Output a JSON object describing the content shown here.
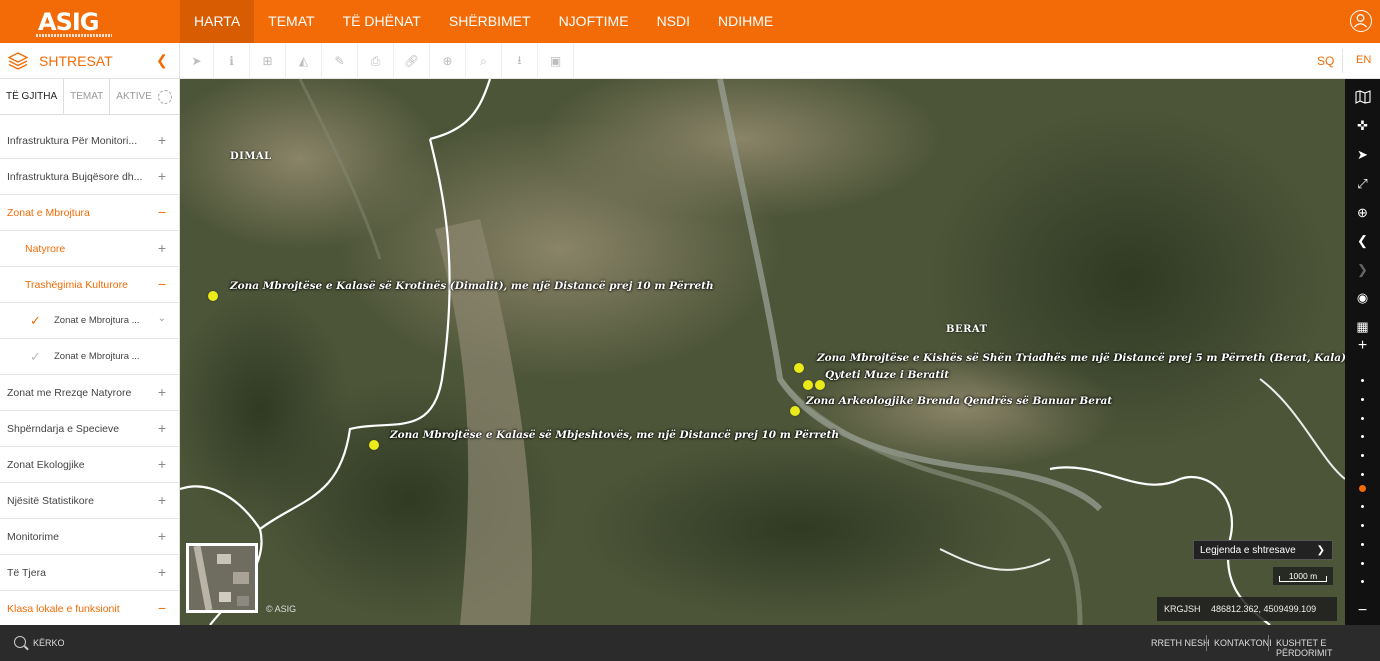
{
  "brand": {
    "logo_text": "ASIG"
  },
  "nav": {
    "items": [
      "HARTA",
      "TEMAT",
      "TË DHËNAT",
      "SHËRBIMET",
      "NJOFTIME",
      "NSDI",
      "NDIHME"
    ],
    "active": "HARTA"
  },
  "layers_panel": {
    "title": "SHTRESAT",
    "tabs": [
      "TË GJITHA",
      "TEMAT",
      "AKTIVE"
    ],
    "active_tab": "TË GJITHA"
  },
  "tree": [
    {
      "label": "Infrastruktura Për Monitori...",
      "level": 1,
      "state": "collapsed"
    },
    {
      "label": "Infrastruktura Bujqësore dh...",
      "level": 1,
      "state": "collapsed"
    },
    {
      "label": "Zonat e Mbrojtura",
      "level": 1,
      "state": "expanded"
    },
    {
      "label": "Natyrore",
      "level": 2,
      "state": "collapsed"
    },
    {
      "label": "Trashëgimia Kulturore",
      "level": 2,
      "state": "expanded"
    },
    {
      "label": "Zonat e Mbrojtura ...",
      "level": 3,
      "checked": true
    },
    {
      "label": "Zonat e Mbrojtura ...",
      "level": 3,
      "checked": false
    },
    {
      "label": "Zonat me Rrezqe Natyrore",
      "level": 1,
      "state": "collapsed"
    },
    {
      "label": "Shpërndarja e Specieve",
      "level": 1,
      "state": "collapsed"
    },
    {
      "label": "Zonat Ekologjike",
      "level": 1,
      "state": "collapsed"
    },
    {
      "label": "Njësitë Statistikore",
      "level": 1,
      "state": "collapsed"
    },
    {
      "label": "Monitorime",
      "level": 1,
      "state": "collapsed"
    },
    {
      "label": "Të Tjera",
      "level": 1,
      "state": "collapsed"
    },
    {
      "label": "Klasa lokale e funksionit",
      "level": 1,
      "state": "expanded"
    }
  ],
  "tree_symbols": {
    "expand": "+",
    "collapse": "−",
    "check": "✓",
    "chevron": "⌄"
  },
  "languages": [
    "SQ",
    "EN"
  ],
  "active_language": "SQ",
  "toolbar_icons": [
    "pointer-icon",
    "info-icon",
    "add-layer-icon",
    "profile-icon",
    "edit-icon",
    "print-icon",
    "link-icon",
    "plus-circle-icon",
    "search-icon",
    "download-icon",
    "image-icon"
  ],
  "map": {
    "place_labels": {
      "dimal": "DIMAL",
      "berat": "BERAT"
    },
    "feature_labels": {
      "krotines": "Zona Mbrojtëse e Kalasë së Krotinës (Dimalit), me një Distancë prej 10 m Përreth",
      "kisha": "Zona Mbrojtëse e Kishës së Shën Triadhës me një Distancë prej 5 m Përreth (Berat, Kala)",
      "qyteti": "Qyteti Muze i Beratit",
      "arkeologjike": "Zona Arkeologjike Brenda Qendrës së Banuar Berat",
      "mbjeshtoves": "Zona Mbrojtëse e Kalasë së Mbjeshtovës, me një Distancë prej 10 m Përreth"
    },
    "copyright": "© ASIG",
    "legend_select": "Legjenda e shtresave",
    "scale": "1000 m",
    "crs": "KRGJSH",
    "coordinates": "486812.362, 4509499.109"
  },
  "footer": {
    "search_label": "KËRKO",
    "links": [
      "RRETH NESH",
      "KONTAKTONI",
      "KUSHTET E PËRDORIMIT"
    ]
  },
  "colors": {
    "accent": "#f26b06",
    "marker": "#ebeb1a",
    "rail": "#111111",
    "footer": "#2b2b2b"
  }
}
